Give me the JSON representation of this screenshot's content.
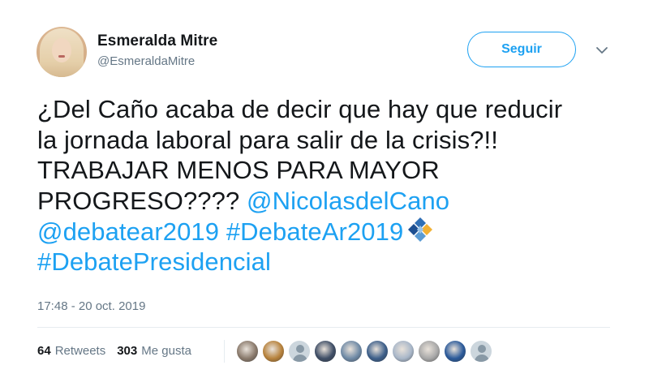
{
  "author": {
    "name": "Esmeralda Mitre",
    "handle": "@EsmeraldaMitre"
  },
  "follow_button": {
    "label": "Seguir"
  },
  "tweet": {
    "lines": [
      [
        {
          "text": "¿Del Caño acaba de decir que hay que reducir",
          "type": "text"
        }
      ],
      [
        {
          "text": "la jornada laboral para salir de la crisis?!!",
          "type": "text"
        }
      ],
      [
        {
          "text": "TRABAJAR MENOS PARA MAYOR",
          "type": "text"
        }
      ],
      [
        {
          "text": "PROGRESO???? ",
          "type": "text"
        },
        {
          "text": "@NicolasdelCano",
          "type": "mention"
        }
      ],
      [
        {
          "text": "@debatear2019",
          "type": "mention"
        },
        {
          "text": " ",
          "type": "text"
        },
        {
          "text": "#DebateAr2019",
          "type": "hashtag"
        }
      ],
      [
        {
          "text": "#DebatePresidencial",
          "type": "hashtag"
        }
      ]
    ],
    "emoji_icon": "debate-ar-diamond-icon"
  },
  "timestamp": "17:48 - 20 oct. 2019",
  "stats": {
    "retweets_count": "64",
    "retweets_label": "Retweets",
    "likes_count": "303",
    "likes_label": "Me gusta"
  },
  "likers": [
    {
      "icon": "liker-avatar-1",
      "color": "#8a7a6c"
    },
    {
      "icon": "liker-avatar-2",
      "color": "#b7823c"
    },
    {
      "icon": "default-avatar-icon",
      "color": "#ccd6dd"
    },
    {
      "icon": "liker-avatar-4",
      "color": "#3f4e66"
    },
    {
      "icon": "liker-avatar-5",
      "color": "#6f8aa6"
    },
    {
      "icon": "liker-avatar-6",
      "color": "#3d5f8a"
    },
    {
      "icon": "liker-avatar-7",
      "color": "#a9b7c9"
    },
    {
      "icon": "liker-avatar-8",
      "color": "#a8a8a8"
    },
    {
      "icon": "liker-avatar-9",
      "color": "#2b5a9a"
    },
    {
      "icon": "default-avatar-icon",
      "color": "#ccd6dd"
    }
  ],
  "colors": {
    "link": "#1da1f2",
    "text": "#14171a",
    "secondary": "#657786",
    "divider": "#e6ecf0"
  }
}
